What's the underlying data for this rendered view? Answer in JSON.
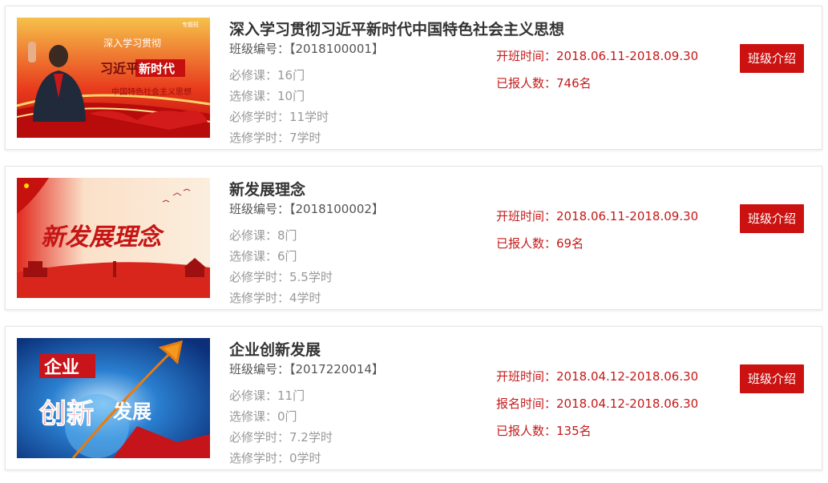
{
  "courses": [
    {
      "title": "深入学习贯彻习近平新时代中国特色社会主义思想",
      "code_label": "班级编号：",
      "code": "【2018100001】",
      "required_courses": "必修课：16门",
      "elective_courses": "选修课：10门",
      "required_hours": "必修学时：11学时",
      "elective_hours": "选修学时：7学时",
      "open_time": "开班时间：2018.06.11-2018.09.30",
      "enrolled": "已报人数：746名",
      "button": "班级介绍",
      "thumb_text": {
        "line1": "深入学习贯彻",
        "line2a": "习近平",
        "line2b": "新时代",
        "line3": "中国特色社会主义思想",
        "tag": "专题班"
      }
    },
    {
      "title": "新发展理念",
      "code_label": "班级编号：",
      "code": "【2018100002】",
      "required_courses": "必修课：8门",
      "elective_courses": "选修课：6门",
      "required_hours": "必修学时：5.5学时",
      "elective_hours": "选修学时：4学时",
      "open_time": "开班时间：2018.06.11-2018.09.30",
      "enrolled": "已报人数：69名",
      "button": "班级介绍",
      "thumb_text": {
        "main": "新发展理念"
      }
    },
    {
      "title": "企业创新发展",
      "code_label": "班级编号：",
      "code": "【2017220014】",
      "required_courses": "必修课：11门",
      "elective_courses": "选修课：0门",
      "required_hours": "必修学时：7.2学时",
      "elective_hours": "选修学时：0学时",
      "open_time": "开班时间：2018.04.12-2018.06.30",
      "signup_time": "报名时间：2018.04.12-2018.06.30",
      "enrolled": "已报人数：135名",
      "button": "班级介绍",
      "thumb_text": {
        "w1": "企业",
        "w2": "创新",
        "w3": "发展"
      }
    }
  ],
  "colors": {
    "accent": "#cc1111",
    "info_text": "#c41a1a",
    "title": "#333333",
    "muted": "#999999"
  }
}
